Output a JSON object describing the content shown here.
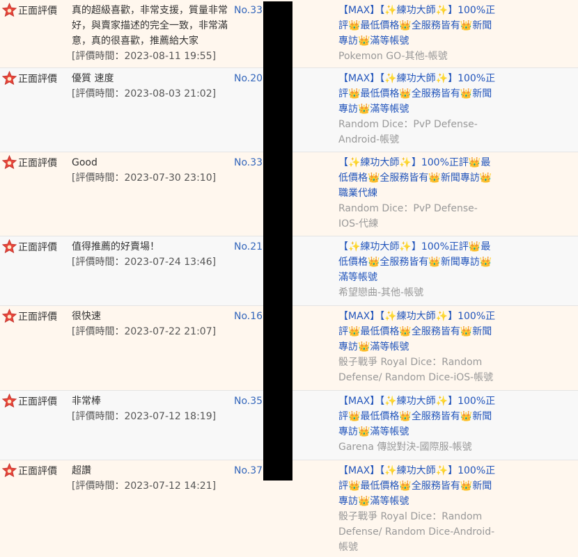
{
  "reviews": [
    {
      "badge": "正面評價",
      "comment": "真的超級喜歡，非常支援，質量非常好，與賣家描述的完全一致，非常滿意，真的很喜歡，推薦給大家",
      "time": "[評價時間：2023-08-11 19:55]",
      "order": "No.331",
      "title": "【MAX】【✨練功大師✨】100%正評👑最低價格👑全服務皆有👑新聞專訪👑滿等帳號",
      "category": "Pokemon GO-其他-帳號"
    },
    {
      "badge": "正面評價",
      "comment": "優質 速度",
      "time": "[評價時間：2023-08-03 21:02]",
      "order": "No.207",
      "title": "【MAX】【✨練功大師✨】100%正評👑最低價格👑全服務皆有👑新聞專訪👑滿等帳號",
      "category": "Random Dice：PvP Defense-Android-帳號"
    },
    {
      "badge": "正面評價",
      "comment": "Good",
      "time": "[評價時間：2023-07-30 23:10]",
      "order": "No.338",
      "title": "【✨練功大師✨】100%正評👑最低價格👑全服務皆有👑新聞專訪👑職業代練",
      "category": "Random Dice：PvP Defense-IOS-代練"
    },
    {
      "badge": "正面評價",
      "comment": "值得推薦的好賣場！",
      "time": "[評價時間：2023-07-24 13:46]",
      "order": "No.211",
      "title": "【✨練功大師✨】100%正評👑最低價格👑全服務皆有👑新聞專訪👑滿等帳號",
      "category": "希望戀曲-其他-帳號"
    },
    {
      "badge": "正面評價",
      "comment": "很快速",
      "time": "[評價時間：2023-07-22 21:07]",
      "order": "No.169",
      "title": "【MAX】【✨練功大師✨】100%正評👑最低價格👑全服務皆有👑新聞專訪👑滿等帳號",
      "category": "骰子戰爭 Royal Dice：Random Defense/ Random Dice-iOS-帳號"
    },
    {
      "badge": "正面評價",
      "comment": "非常棒",
      "time": "[評價時間：2023-07-12 18:19]",
      "order": "No.351",
      "title": "【MAX】【✨練功大師✨】100%正評👑最低價格👑全服務皆有👑新聞專訪👑滿等帳號",
      "category": "Garena 傳說對決-國際服-帳號"
    },
    {
      "badge": "正面評價",
      "comment": "超讚",
      "time": "[評價時間：2023-07-12 14:21]",
      "order": "No.370",
      "title": "【MAX】【✨練功大師✨】100%正評👑最低價格👑全服務皆有👑新聞專訪👑滿等帳號",
      "category": "骰子戰爭 Royal Dice：Random Defense/ Random Dice-Android-帳號"
    }
  ],
  "colors": {
    "badge_red": "#e8463a",
    "link_blue": "#2255bb",
    "row_odd": "#fff7ee",
    "row_even": "#f8f8f8"
  }
}
